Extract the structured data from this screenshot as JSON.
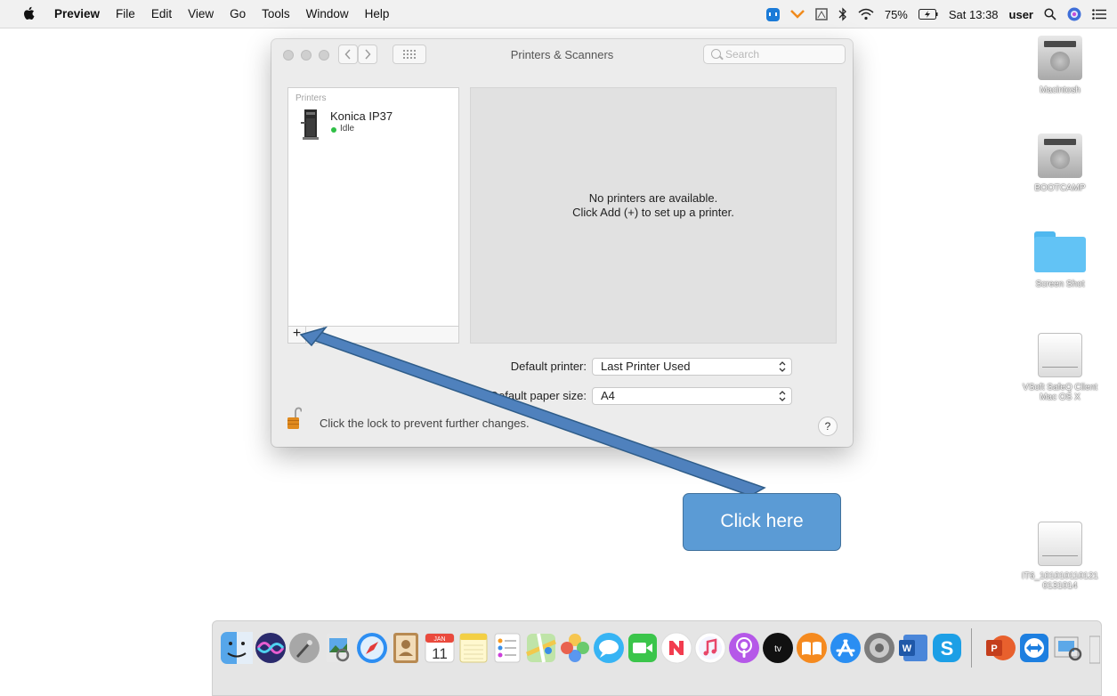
{
  "menubar": {
    "items": [
      "Preview",
      "File",
      "Edit",
      "View",
      "Go",
      "Tools",
      "Window",
      "Help"
    ],
    "battery": "75%",
    "clock": "Sat 13:38",
    "user": "user"
  },
  "window": {
    "title": "Printers & Scanners",
    "search_placeholder": "Search",
    "list_header": "Printers",
    "printers": [
      {
        "name": "Konica IP37",
        "status": "Idle"
      }
    ],
    "add_button": "+",
    "remove_button": "−",
    "empty_line1": "No printers are available.",
    "empty_line2": "Click Add (+) to set up a printer.",
    "default_printer_label": "Default printer:",
    "default_printer_value": "Last Printer Used",
    "paper_size_label": "Default paper size:",
    "paper_size_value": "A4",
    "lock_text": "Click the lock to prevent further changes.",
    "help_label": "?"
  },
  "annotation": {
    "callout_text": "Click here",
    "color": "#5b9bd5"
  },
  "desktop": {
    "icons": [
      {
        "label": "Macintosh",
        "kind": "hard-drive-icon"
      },
      {
        "label": "BOOTCAMP",
        "kind": "hard-drive-icon"
      },
      {
        "label": "Screen Shot",
        "kind": "folder-icon"
      },
      {
        "label": "VSoft SafeQ Client Mac OS X",
        "kind": "external-drive-icon"
      },
      {
        "label": "IT6_101010110121 0131014",
        "kind": "external-drive-icon"
      }
    ]
  },
  "dock": {
    "apps": [
      "finder-icon",
      "siri-icon",
      "launchpad-icon",
      "preview-icon",
      "safari-icon",
      "contacts-icon",
      "calendar-icon",
      "notes-icon",
      "reminders-icon",
      "maps-icon",
      "photos-icon",
      "messages-icon",
      "facetime-icon",
      "news-icon",
      "music-icon",
      "podcasts-icon",
      "tv-icon",
      "books-icon",
      "app-store-icon",
      "system-preferences-icon",
      "word-icon",
      "skype-icon",
      "powerpoint-icon",
      "teamviewer-icon",
      "preview-docs-icon",
      "trash-icon"
    ],
    "calendar_month": "JAN",
    "calendar_day": "11",
    "tv_label": "tv"
  }
}
